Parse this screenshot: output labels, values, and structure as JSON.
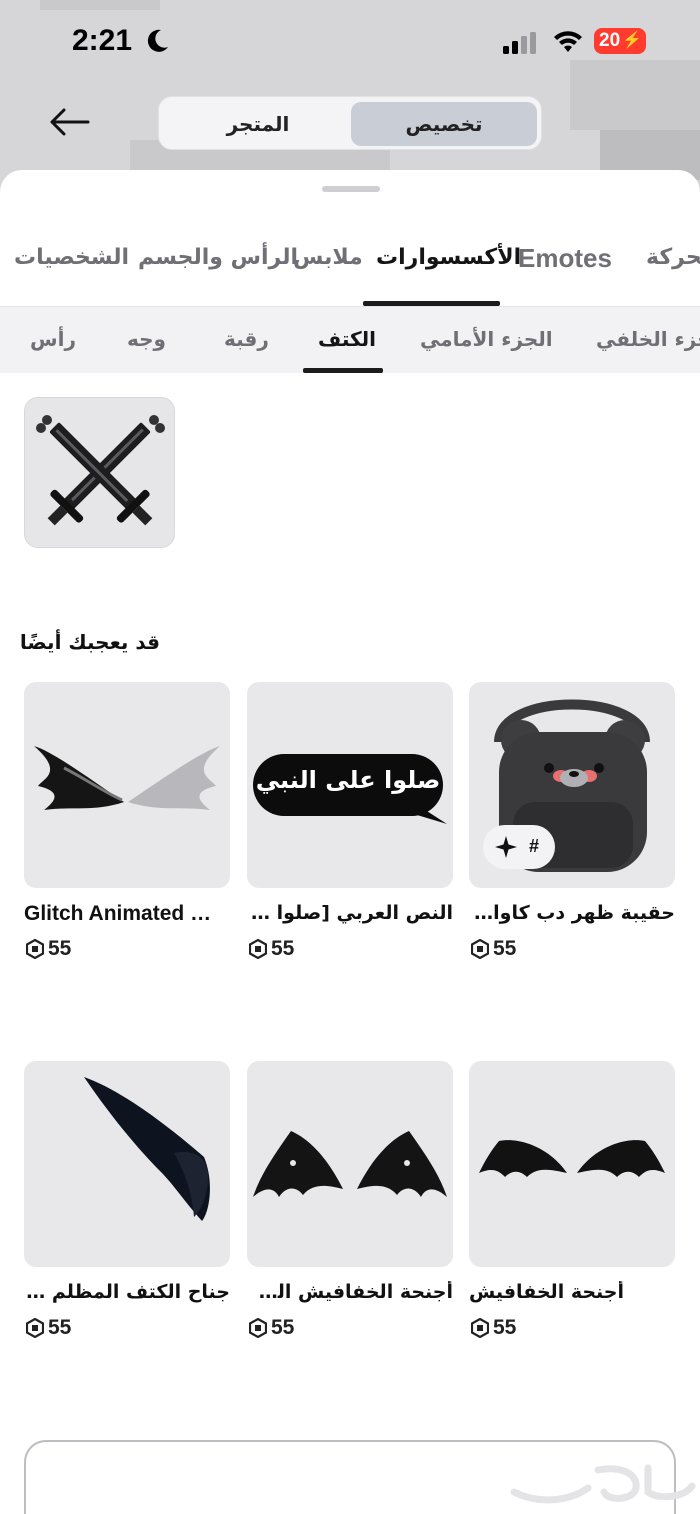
{
  "status_bar": {
    "time": "2:21",
    "battery": "20"
  },
  "header": {
    "segment_store": "المتجر",
    "segment_customize": "تخصيص"
  },
  "tabs": [
    {
      "label": "الحركة",
      "active": false
    },
    {
      "label": "Emotes",
      "active": false
    },
    {
      "label": "الأكسسوارات",
      "active": true
    },
    {
      "label": "ملابس",
      "active": false
    },
    {
      "label": "الرأس والجسم",
      "active": false
    },
    {
      "label": "الشخصيات",
      "active": false
    }
  ],
  "subtabs": [
    {
      "label": "الجزء الخلفي",
      "active": false
    },
    {
      "label": "الجزء الأمامي",
      "active": false
    },
    {
      "label": "الكتف",
      "active": true
    },
    {
      "label": "رقبة",
      "active": false
    },
    {
      "label": "وجه",
      "active": false
    },
    {
      "label": "رأس",
      "active": false
    }
  ],
  "recommendations": {
    "title": "قد يعجبك أيضًا",
    "items": [
      {
        "name": "حقيبة ظهر دب كاواي لطيفة",
        "price": "55",
        "badge": "#"
      },
      {
        "name": "النص العربي [صلوا على النبي]",
        "price": "55",
        "image_text": "صلوا على النبي"
      },
      {
        "name": "Glitch Animated Wings",
        "price": "55"
      },
      {
        "name": "أجنحة الخفافيش",
        "price": "55"
      },
      {
        "name": "أجنحة الخفافيش السوداء",
        "price": "55"
      },
      {
        "name": "جناح الكتف المظلم (يمين)",
        "price": "55"
      }
    ]
  },
  "colors": {
    "accent_dark": "#1c1c1c",
    "battery_red": "#ff3b30",
    "card_bg": "#e8e8ea"
  }
}
